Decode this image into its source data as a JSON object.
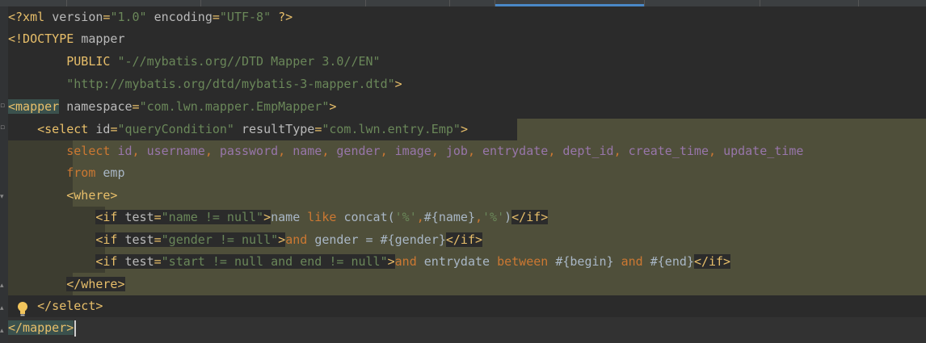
{
  "editor": {
    "language": "XML",
    "lines": [
      {
        "segments": [
          [
            "tag",
            "<?xml "
          ],
          [
            "attr",
            "version"
          ],
          [
            "tag",
            "="
          ],
          [
            "str",
            "\"1.0\""
          ],
          [
            "attr",
            " encoding"
          ],
          [
            "tag",
            "="
          ],
          [
            "str",
            "\"UTF-8\""
          ],
          [
            "tag",
            " ?>"
          ]
        ]
      },
      {
        "segments": [
          [
            "tag",
            "<!DOCTYPE "
          ],
          [
            "attr",
            "mapper"
          ]
        ]
      },
      {
        "segments": [
          [
            "tag",
            "        PUBLIC "
          ],
          [
            "str",
            "\"-//mybatis.org//DTD Mapper 3.0//EN\""
          ]
        ]
      },
      {
        "segments": [
          [
            "str",
            "        \"http://mybatis.org/dtd/mybatis-3-mapper.dtd\""
          ],
          [
            "tag",
            ">"
          ]
        ]
      },
      {
        "segments": [
          [
            "tag-hl",
            "<mapper"
          ],
          [
            "attr",
            " namespace"
          ],
          [
            "tag",
            "="
          ],
          [
            "str",
            "\"com.lwn.mapper.EmpMapper\""
          ],
          [
            "tag",
            ">"
          ]
        ]
      },
      {
        "segments": [
          [
            "txt",
            "    "
          ],
          [
            "tag",
            "<select "
          ],
          [
            "attr",
            "id"
          ],
          [
            "tag",
            "="
          ],
          [
            "str",
            "\"queryCondition\""
          ],
          [
            "attr",
            " resultType"
          ],
          [
            "tag",
            "="
          ],
          [
            "str",
            "\"com.lwn.entry.Emp\""
          ],
          [
            "tag",
            ">"
          ]
        ]
      },
      {
        "segments": [
          [
            "txt",
            "        "
          ],
          [
            "kw",
            "select "
          ],
          [
            "col",
            "id"
          ],
          [
            "kw",
            ", "
          ],
          [
            "col",
            "username"
          ],
          [
            "kw",
            ", "
          ],
          [
            "col",
            "password"
          ],
          [
            "kw",
            ", "
          ],
          [
            "col",
            "name"
          ],
          [
            "kw",
            ", "
          ],
          [
            "col",
            "gender"
          ],
          [
            "kw",
            ", "
          ],
          [
            "col",
            "image"
          ],
          [
            "kw",
            ", "
          ],
          [
            "col",
            "job"
          ],
          [
            "kw",
            ", "
          ],
          [
            "col",
            "entrydate"
          ],
          [
            "kw",
            ", "
          ],
          [
            "col",
            "dept_id"
          ],
          [
            "kw",
            ", "
          ],
          [
            "col",
            "create_time"
          ],
          [
            "kw",
            ", "
          ],
          [
            "col",
            "update_time"
          ]
        ]
      },
      {
        "segments": [
          [
            "txt",
            "        "
          ],
          [
            "kw",
            "from "
          ],
          [
            "txt",
            "emp"
          ]
        ]
      },
      {
        "segments": [
          [
            "txt",
            "        "
          ],
          [
            "tag",
            "<where>"
          ]
        ]
      },
      {
        "segments": [
          [
            "txt",
            "            "
          ],
          [
            "tagbox",
            "<if "
          ],
          [
            "attrbox",
            "test"
          ],
          [
            "tagbox",
            "="
          ],
          [
            "strbox",
            "\"name != null\""
          ],
          [
            "tagbox",
            ">"
          ],
          [
            "txt",
            "name "
          ],
          [
            "kw",
            "like "
          ],
          [
            "txt",
            "concat("
          ],
          [
            "str",
            "'%'"
          ],
          [
            "kw",
            ","
          ],
          [
            "txt",
            "#{name}"
          ],
          [
            "kw",
            ","
          ],
          [
            "str",
            "'%'"
          ],
          [
            "txt",
            ")"
          ],
          [
            "tagbox",
            "</if>"
          ]
        ]
      },
      {
        "segments": [
          [
            "txt",
            "            "
          ],
          [
            "tagbox",
            "<if "
          ],
          [
            "attrbox",
            "test"
          ],
          [
            "tagbox",
            "="
          ],
          [
            "strbox",
            "\"gender != null\""
          ],
          [
            "tagbox",
            ">"
          ],
          [
            "kw",
            "and "
          ],
          [
            "txt",
            "gender = #{gender}"
          ],
          [
            "tagbox",
            "</if>"
          ]
        ]
      },
      {
        "segments": [
          [
            "txt",
            "            "
          ],
          [
            "tagbox",
            "<if "
          ],
          [
            "attrbox",
            "test"
          ],
          [
            "tagbox",
            "="
          ],
          [
            "strbox",
            "\"start != null and end != null\""
          ],
          [
            "tagbox",
            ">"
          ],
          [
            "kw",
            "and "
          ],
          [
            "txt",
            "entrydate "
          ],
          [
            "kw",
            "between "
          ],
          [
            "txt",
            "#{begin} "
          ],
          [
            "kw",
            "and "
          ],
          [
            "txt",
            "#{end}"
          ],
          [
            "tagbox",
            "</if>"
          ]
        ]
      },
      {
        "segments": [
          [
            "txt",
            "        "
          ],
          [
            "tagbox",
            "</where>"
          ]
        ]
      },
      {
        "segments": [
          [
            "txt",
            "    "
          ],
          [
            "tag",
            "</select>"
          ]
        ]
      },
      {
        "segments": [
          [
            "tag-hl",
            "</mapper>"
          ]
        ]
      }
    ]
  },
  "icons": {
    "intention": "lightbulb-icon",
    "fold": "fold-marker-icon"
  },
  "colors": {
    "background": "#2b2b2b",
    "tag": "#e8bf6a",
    "attribute": "#bababa",
    "string": "#6a8759",
    "keyword": "#cc7832",
    "column": "#9876aa",
    "block_highlight": "#4f4f3a"
  }
}
